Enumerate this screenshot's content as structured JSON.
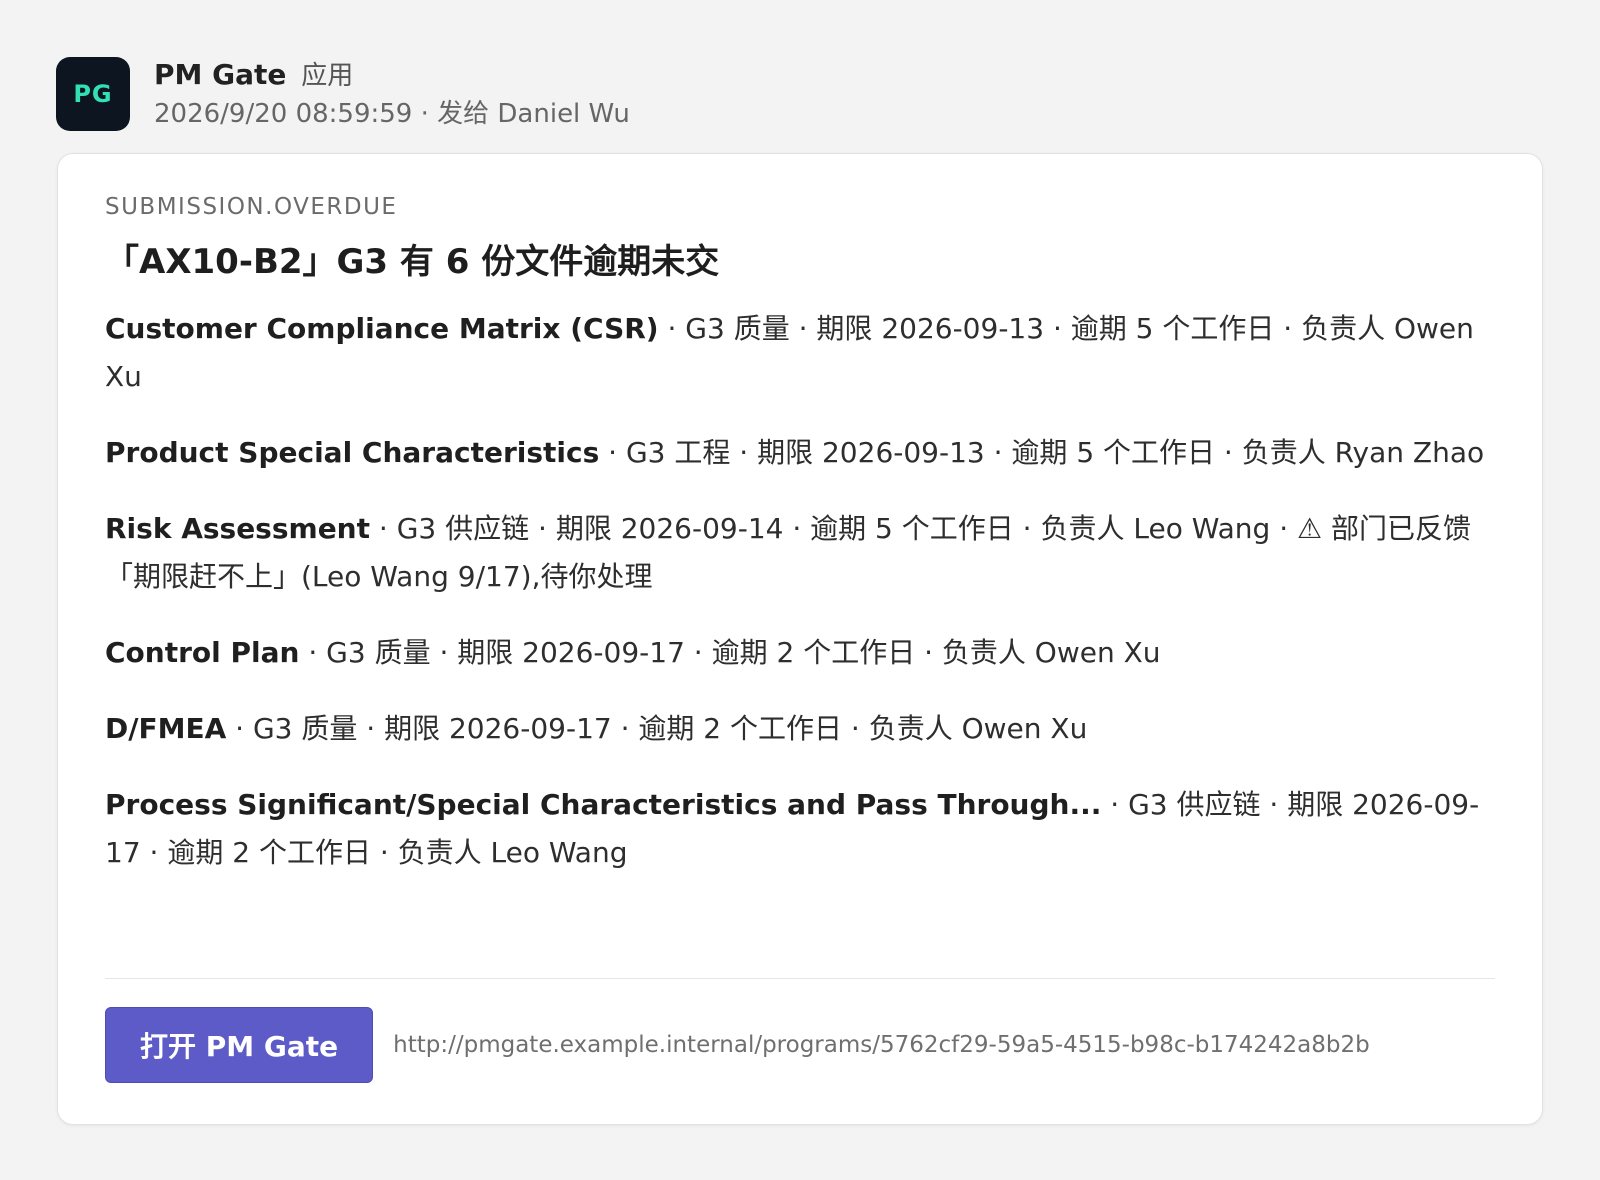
{
  "header": {
    "avatar_text": "PG",
    "sender": "PM Gate",
    "sender_tag": "应用",
    "subline": "2026/9/20 08:59:59 · 发给 Daniel Wu"
  },
  "card": {
    "event_type": "SUBMISSION.OVERDUE",
    "title": "「AX10-B2」G3 有 6 份文件逾期未交",
    "items": [
      {
        "name": "Customer Compliance Matrix (CSR)",
        "detail": " · G3 质量 · 期限 2026-09-13 · 逾期 5 个工作日 · 负责人 Owen Xu"
      },
      {
        "name": "Product Special Characteristics",
        "detail": " · G3 工程 · 期限 2026-09-13 · 逾期 5 个工作日 · 负责人 Ryan Zhao"
      },
      {
        "name": "Risk Assessment",
        "detail": " · G3 供应链 · 期限 2026-09-14 · 逾期 5 个工作日 · 负责人 Leo Wang · ⚠ 部门已反馈「期限赶不上」(Leo Wang 9/17),待你处理"
      },
      {
        "name": "Control Plan",
        "detail": " · G3 质量 · 期限 2026-09-17 · 逾期 2 个工作日 · 负责人 Owen Xu"
      },
      {
        "name": "D/FMEA",
        "detail": " · G3 质量 · 期限 2026-09-17 · 逾期 2 个工作日 · 负责人 Owen Xu"
      },
      {
        "name": "Process Significant/Special Characteristics and Pass Through...",
        "detail": " · G3 供应链 · 期限 2026-09-17 · 逾期 2 个工作日 · 负责人 Leo Wang"
      }
    ],
    "button_label": "打开 PM Gate",
    "url": "http://pmgate.example.internal/programs/5762cf29-59a5-4515-b98c-b174242a8b2b"
  },
  "colors": {
    "background": "#f3f3f3",
    "avatar_bg": "#0c1520",
    "avatar_text": "#33e0b5",
    "button_bg": "#5c5bc8"
  }
}
